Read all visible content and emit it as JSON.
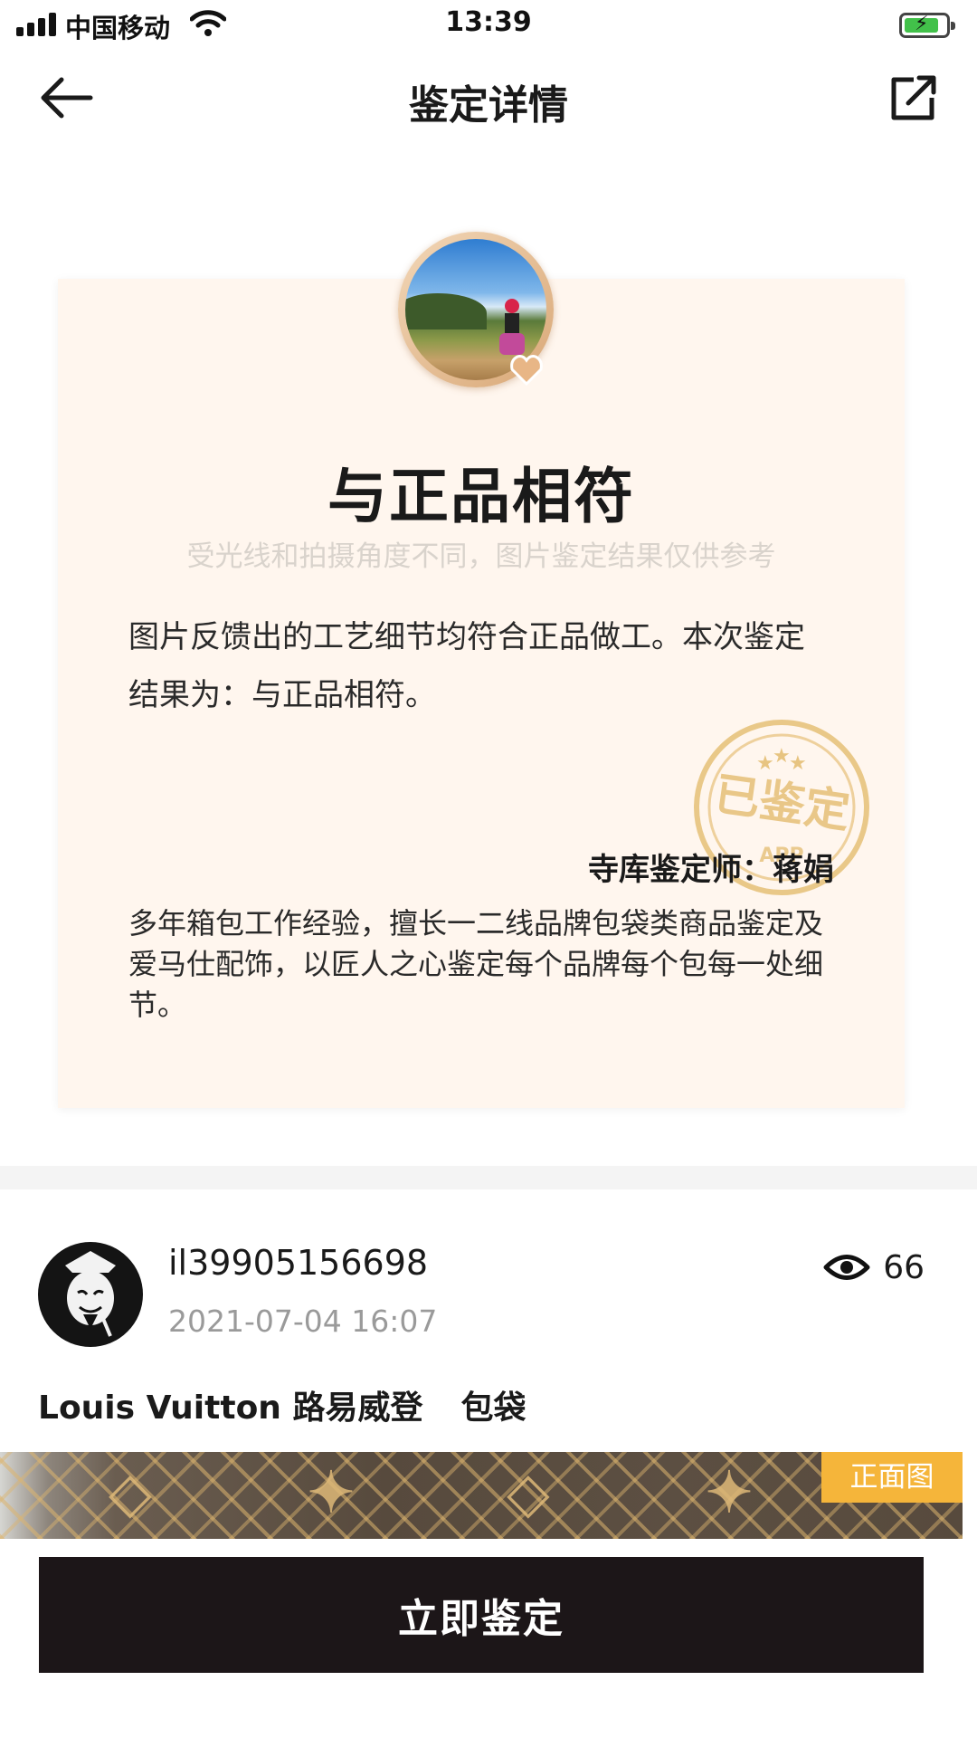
{
  "status_bar": {
    "carrier": "中国移动",
    "time": "13:39"
  },
  "nav": {
    "title": "鉴定详情",
    "back_icon": "arrow-left-icon",
    "share_icon": "share-icon"
  },
  "certificate": {
    "result": "与正品相符",
    "note": "受光线和拍摄角度不同，图片鉴定结果仅供参考",
    "description": "图片反馈出的工艺细节均符合正品做工。本次鉴定结果为：与正品相符。",
    "appraiser": "寺库鉴定师：蒋娟",
    "appraiser_bio": "多年箱包工作经验，擅长一二线品牌包袋类商品鉴定及爱马仕配饰，以匠人之心鉴定每个品牌每个包每一处细节。",
    "stamp_text": "已鉴定",
    "stamp_sub": "APP",
    "stamp_color": "#e2b866"
  },
  "post": {
    "username": "il39905156698",
    "time": "2021-07-04 16:07",
    "views": "66",
    "brand": "Louis Vuitton 路易威登",
    "category": "包袋",
    "photo_tag": "正面图"
  },
  "cta": {
    "label": "立即鉴定"
  },
  "colors": {
    "card_bg": "#fff6ee",
    "cta_bg": "#1c1618",
    "tag_bg": "#f5b53a"
  }
}
